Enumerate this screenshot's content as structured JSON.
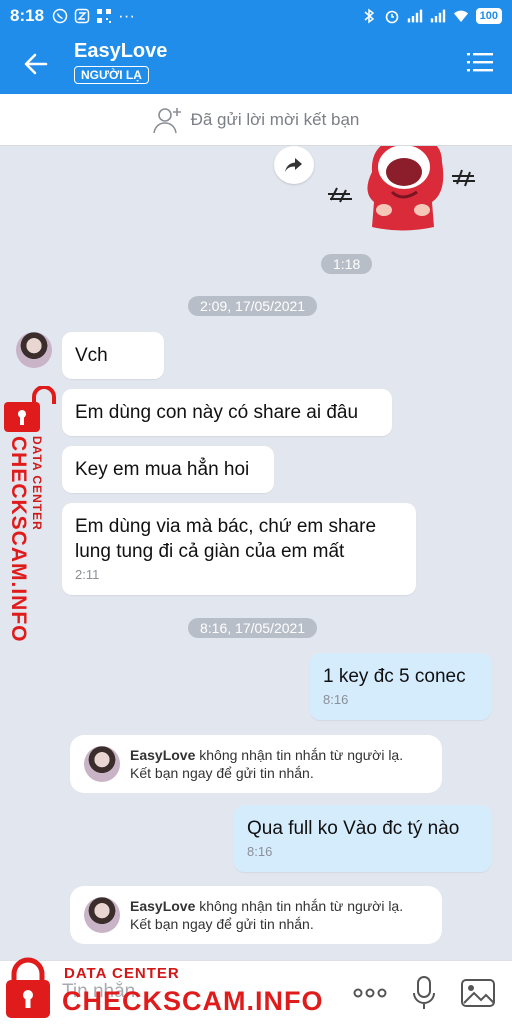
{
  "status_bar": {
    "time": "8:18",
    "battery": "100"
  },
  "header": {
    "title": "EasyLove",
    "badge": "NGƯỜI LẠ"
  },
  "friend_request": {
    "text": "Đã gửi lời mời kết bạn"
  },
  "messages": [
    {
      "kind": "time",
      "text": "1:18"
    },
    {
      "kind": "date",
      "text": "2:09, 17/05/2021"
    },
    {
      "kind": "incoming",
      "text": "Vch"
    },
    {
      "kind": "incoming",
      "text": "Em dùng con này có share ai đâu"
    },
    {
      "kind": "incoming",
      "text": "Key em mua hẳn hoi"
    },
    {
      "kind": "incoming",
      "text": "Em dùng via mà bác, chứ em share lung tung đi cả giàn của em mất",
      "time": "2:11"
    },
    {
      "kind": "date",
      "text": "8:16, 17/05/2021"
    },
    {
      "kind": "outgoing",
      "text": "1 key đc 5 conec",
      "time": "8:16"
    },
    {
      "kind": "notice",
      "name": "EasyLove",
      "text": " không nhận tin nhắn từ người lạ.",
      "text2": "Kết bạn ngay để gửi tin nhắn."
    },
    {
      "kind": "outgoing",
      "text": "Qua full ko Vào đc tý nào",
      "time": "8:16"
    },
    {
      "kind": "notice",
      "name": "EasyLove",
      "text": " không nhận tin nhắn từ người lạ.",
      "text2": "Kết bạn ngay để gửi tin nhắn."
    }
  ],
  "input": {
    "placeholder": "Tin nhắn"
  },
  "watermark": {
    "line1": "DATA CENTER",
    "line2": "CHECKSCAM.INFO"
  },
  "colors": {
    "header": "#1f8de9",
    "outgoing_bubble": "#d5ecfd",
    "incoming_bubble": "#ffffff",
    "chat_bg": "#e2e6ee",
    "watermark": "#e01b1b"
  }
}
